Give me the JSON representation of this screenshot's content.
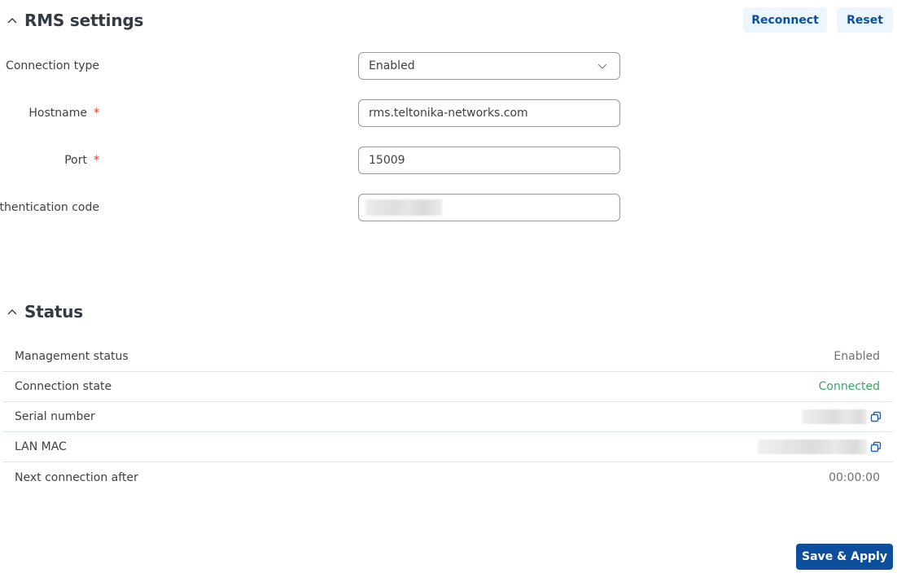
{
  "rms_settings": {
    "title": "RMS settings",
    "collapse_icon": "chevron-up-icon",
    "buttons": {
      "reconnect": "Reconnect",
      "reset": "Reset"
    },
    "fields": {
      "connection_type": {
        "label": "Connection type",
        "value": "Enabled",
        "required": false
      },
      "hostname": {
        "label": "Hostname",
        "value": "rms.teltonika-networks.com",
        "required": true
      },
      "port": {
        "label": "Port",
        "value": "15009",
        "required": true
      },
      "auth_code": {
        "label": "Authentication code",
        "value": "",
        "redacted": true,
        "required": false
      }
    },
    "required_marker": "*"
  },
  "status": {
    "title": "Status",
    "collapse_icon": "chevron-up-icon",
    "rows": [
      {
        "key": "Management status",
        "value": "Enabled"
      },
      {
        "key": "Connection state",
        "value": "Connected",
        "color": "#3aa56a"
      },
      {
        "key": "Serial number",
        "value": "",
        "redacted": true,
        "icon": "copy-icon"
      },
      {
        "key": "LAN MAC",
        "value": "",
        "redacted": true,
        "icon": "copy-icon"
      },
      {
        "key": "Next connection after",
        "value": "00:00:00"
      }
    ]
  },
  "footer": {
    "save_apply": "Save & Apply"
  },
  "colors": {
    "primary": "#0d4f9c",
    "light_button_bg": "#eef6fd",
    "light_button_text": "#0b4f9e",
    "required": "#e03b3b",
    "success": "#3aa56a"
  }
}
